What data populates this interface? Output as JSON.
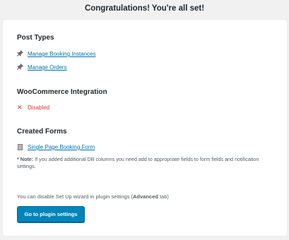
{
  "header": {
    "title": "Congratulations! You're all set!"
  },
  "post_types": {
    "title": "Post Types",
    "items": [
      {
        "label": "Manage Booking Instances",
        "icon": "pin-icon"
      },
      {
        "label": "Manage Orders",
        "icon": "pin-icon"
      }
    ]
  },
  "woocommerce": {
    "title": "WooCommerce Integration",
    "status_icon": "cross-icon",
    "status": "Disabled",
    "status_color": "#dc3232"
  },
  "forms": {
    "title": "Created Forms",
    "items": [
      {
        "label": "Single Page Booking Form",
        "icon": "form-icon"
      }
    ],
    "note_prefix": "* Note:",
    "note_text": " If you added additional DB columns you need add to appropriate fields to form fields and notification settings."
  },
  "footer": {
    "hint_before": "You can disable Set Up wizard in plugin settings (",
    "hint_bold": "Advanced",
    "hint_after": " tab)",
    "button_label": "Go to plugin settings",
    "button_color": "#0085ba"
  },
  "colors": {
    "link": "#0073aa",
    "background": "#f1f1f1"
  }
}
